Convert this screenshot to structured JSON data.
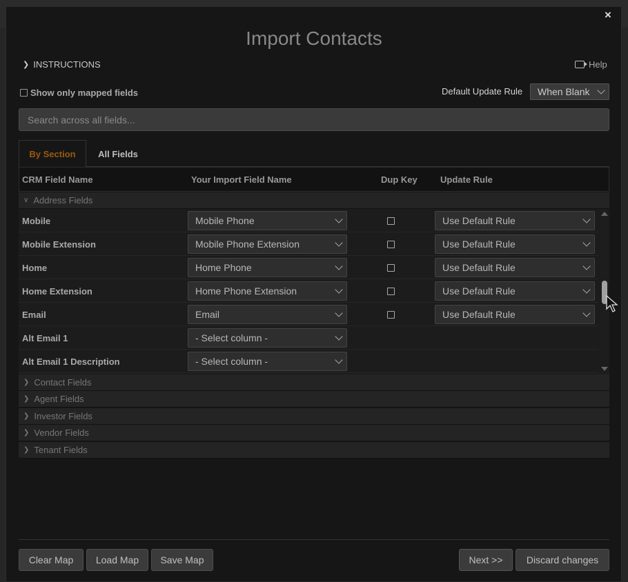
{
  "dialog": {
    "title": "Import Contacts",
    "close_label": "×",
    "instructions_label": "INSTRUCTIONS",
    "help_label": "Help",
    "show_mapped_label": "Show only mapped fields",
    "default_update_rule_label": "Default Update Rule",
    "default_update_rule_value": "When Blank",
    "search_placeholder": "Search across all fields...",
    "tabs": [
      {
        "label": "By Section",
        "active": true
      },
      {
        "label": "All Fields",
        "active": false
      }
    ]
  },
  "grid": {
    "columns": [
      "CRM Field Name",
      "Your Import Field Name",
      "Dup Key",
      "Update Rule"
    ],
    "expanded_section": "Address Fields",
    "rows": [
      {
        "field": "Mobile",
        "import": "Mobile Phone",
        "dup_key": false,
        "rule": "Use Default Rule"
      },
      {
        "field": "Mobile Extension",
        "import": "Mobile Phone Extension",
        "dup_key": false,
        "rule": "Use Default Rule"
      },
      {
        "field": "Home",
        "import": "Home Phone",
        "dup_key": false,
        "rule": "Use Default Rule"
      },
      {
        "field": "Home Extension",
        "import": "Home Phone Extension",
        "dup_key": false,
        "rule": "Use Default Rule"
      },
      {
        "field": "Email",
        "import": "Email",
        "dup_key": false,
        "rule": "Use Default Rule"
      },
      {
        "field": "Alt Email 1",
        "import": "- Select column -"
      },
      {
        "field": "Alt Email 1 Description",
        "import": "- Select column -"
      }
    ],
    "collapsed_sections": [
      "Contact Fields",
      "Agent Fields",
      "Investor Fields",
      "Vendor Fields",
      "Tenant Fields"
    ]
  },
  "footer": {
    "clear_map": "Clear Map",
    "load_map": "Load Map",
    "save_map": "Save Map",
    "next": "Next >>",
    "discard": "Discard changes"
  },
  "colors": {
    "active_tab": "#9a5a10",
    "overlay": "#161616"
  },
  "icons": [
    "chevron-right-icon",
    "chevron-down-icon",
    "video-icon",
    "close-icon",
    "caret-down-icon",
    "scroll-up-icon",
    "scroll-down-icon",
    "mouse-cursor-icon"
  ]
}
